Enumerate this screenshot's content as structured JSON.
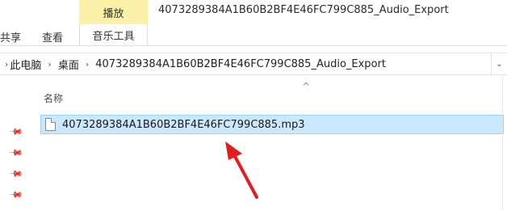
{
  "ribbon": {
    "context_group_label": "播放",
    "context_tab_label": "音乐工具",
    "share_tab_label": "共享",
    "view_tab_label": "查看"
  },
  "window": {
    "title": "4073289384A1B60B2BF4E46FC799C885_Audio_Export"
  },
  "address_bar": {
    "crumbs": [
      "此电脑",
      "桌面",
      "4073289384A1B60B2BF4E46FC799C885_Audio_Export"
    ],
    "separator": "›",
    "dropdown": "⌄"
  },
  "file_list": {
    "column_name_header": "名称",
    "sort_indicator": "^",
    "files": [
      {
        "name": "4073289384A1B60B2BF4E46FC799C885.mp3",
        "selected": true
      }
    ]
  },
  "nav_pane": {
    "pins": [
      "📌",
      "📌",
      "📌",
      "📌"
    ]
  },
  "colors": {
    "context_tab_bg": "#fbf0a8",
    "selection_bg": "#cce8ff",
    "selection_border": "#99d1ff",
    "annotation_arrow": "#e02020"
  }
}
